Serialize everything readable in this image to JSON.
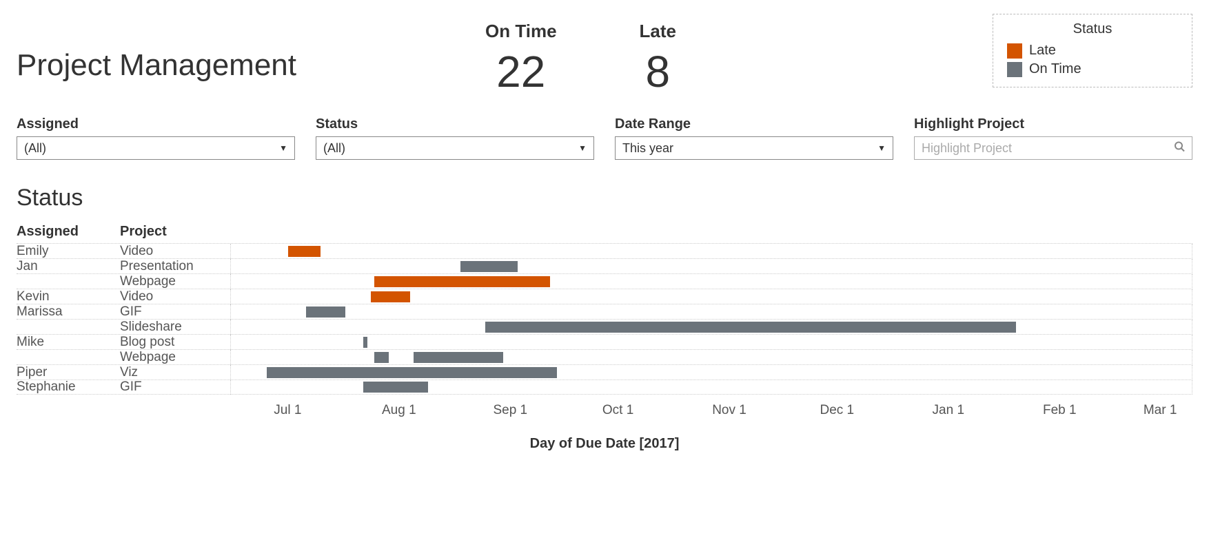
{
  "header": {
    "title": "Project Management",
    "kpis": [
      {
        "label": "On Time",
        "value": "22"
      },
      {
        "label": "Late",
        "value": "8"
      }
    ]
  },
  "legend": {
    "title": "Status",
    "items": [
      {
        "label": "Late",
        "color": "#d35400"
      },
      {
        "label": "On Time",
        "color": "#6b737a"
      }
    ]
  },
  "filters": {
    "assigned": {
      "label": "Assigned",
      "value": "(All)"
    },
    "status": {
      "label": "Status",
      "value": "(All)"
    },
    "dateRange": {
      "label": "Date Range",
      "value": "This year"
    },
    "highlight": {
      "label": "Highlight Project",
      "placeholder": "Highlight Project"
    }
  },
  "chart": {
    "section_title": "Status",
    "columns": {
      "assigned": "Assigned",
      "project": "Project"
    },
    "axis_label": "Day of Due Date [2017]"
  },
  "chart_data": {
    "type": "gantt",
    "title": "Status",
    "xlabel": "Day of Due Date [2017]",
    "x_ticks": [
      "Jul 1",
      "Aug 1",
      "Sep 1",
      "Oct 1",
      "Nov 1",
      "Dec 1",
      "Jan 1",
      "Feb 1",
      "Mar 1"
    ],
    "x_range_days": [
      "2017-06-15",
      "2018-03-10"
    ],
    "colors": {
      "Late": "#d35400",
      "On Time": "#6b737a"
    },
    "rows": [
      {
        "assigned": "Emily",
        "project": "Video",
        "status": "Late",
        "start": "2017-07-01",
        "end": "2017-07-10"
      },
      {
        "assigned": "Jan",
        "project": "Presentation",
        "status": "On Time",
        "start": "2017-08-18",
        "end": "2017-09-03"
      },
      {
        "assigned": "Jan",
        "project": "Webpage",
        "status": "Late",
        "start": "2017-07-25",
        "end": "2017-09-12"
      },
      {
        "assigned": "Kevin",
        "project": "Video",
        "status": "Late",
        "start": "2017-07-24",
        "end": "2017-08-04"
      },
      {
        "assigned": "Marissa",
        "project": "GIF",
        "status": "On Time",
        "start": "2017-07-06",
        "end": "2017-07-17"
      },
      {
        "assigned": "Marissa",
        "project": "Slideshare",
        "status": "On Time",
        "start": "2017-08-25",
        "end": "2018-01-20"
      },
      {
        "assigned": "Mike",
        "project": "Blog post",
        "status": "On Time",
        "start": "2017-07-22",
        "end": "2017-07-23"
      },
      {
        "assigned": "Mike",
        "project": "Webpage",
        "status": "On Time",
        "start": "2017-08-05",
        "end": "2017-08-30"
      },
      {
        "assigned": "Mike",
        "project": "Webpage",
        "status": "On Time",
        "start": "2017-07-25",
        "end": "2017-07-29",
        "segment": 2
      },
      {
        "assigned": "Piper",
        "project": "Viz",
        "status": "On Time",
        "start": "2017-06-25",
        "end": "2017-09-14"
      },
      {
        "assigned": "Stephanie",
        "project": "GIF",
        "status": "On Time",
        "start": "2017-07-22",
        "end": "2017-08-09"
      }
    ]
  }
}
